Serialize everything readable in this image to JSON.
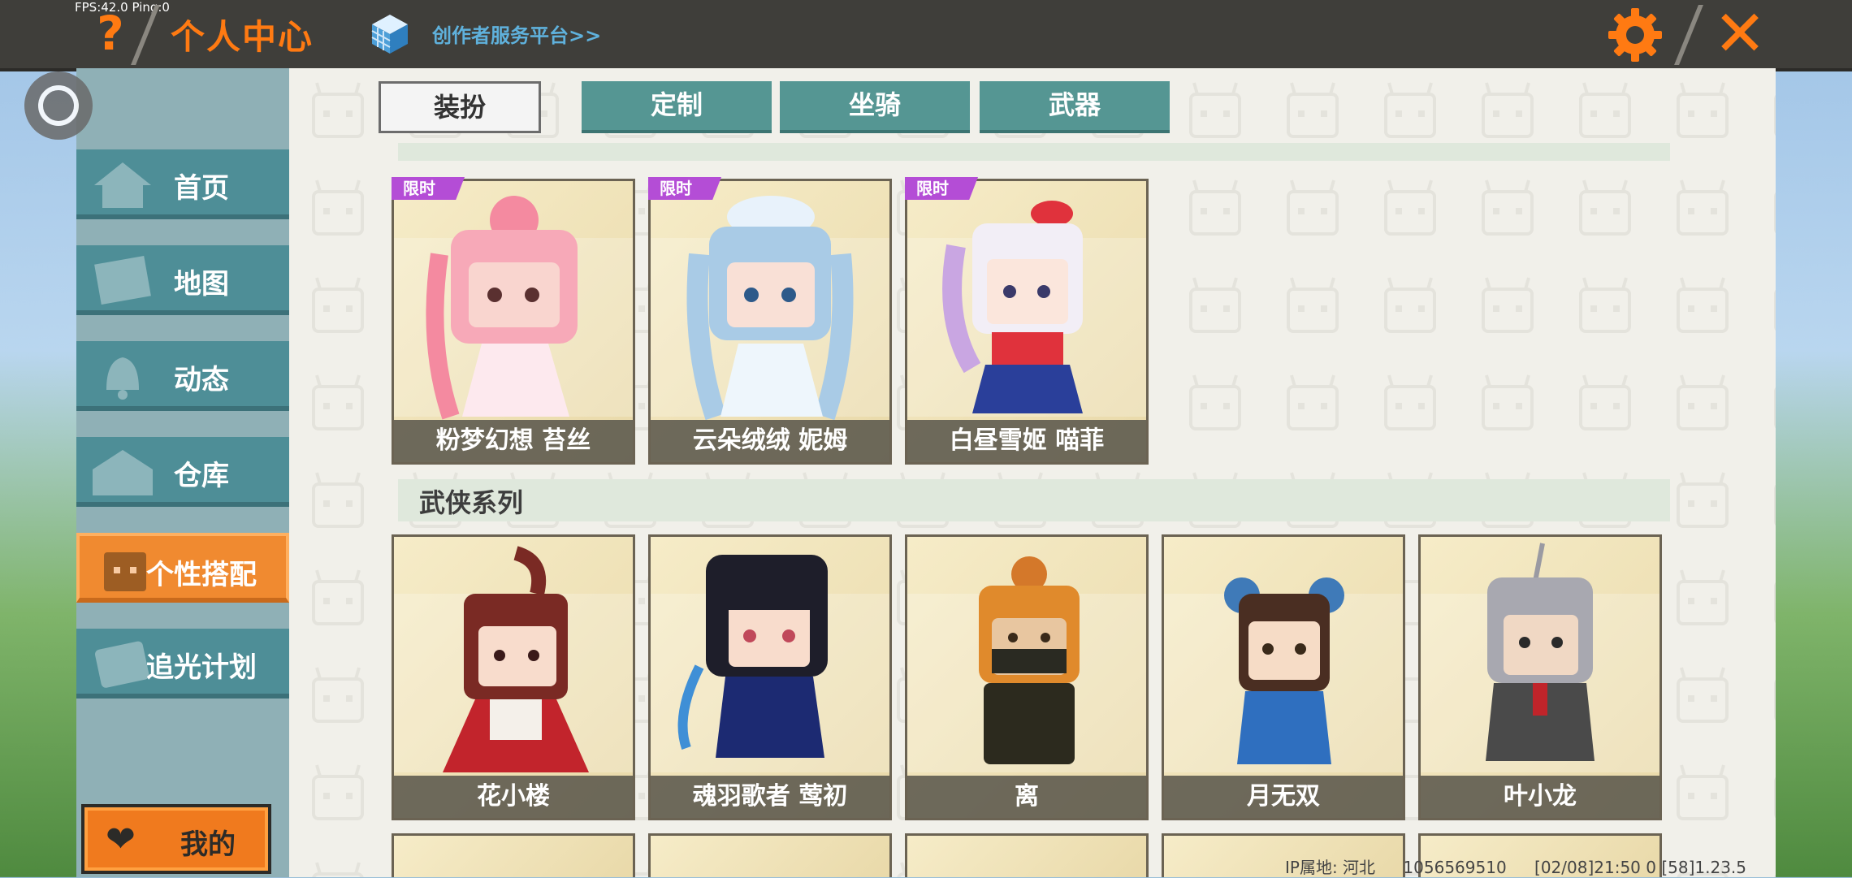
{
  "debug": {
    "fps": "FPS:42.0",
    "ping": "Ping:0"
  },
  "header": {
    "title": "个人中心",
    "creator_link": "创作者服务平台>>",
    "help_icon": "question-icon",
    "settings_icon": "gear-icon",
    "close_icon": "close-icon"
  },
  "sidebar": {
    "items": [
      {
        "label": "首页",
        "icon": "home-icon"
      },
      {
        "label": "地图",
        "icon": "map-icon"
      },
      {
        "label": "动态",
        "icon": "bell-icon"
      },
      {
        "label": "仓库",
        "icon": "warehouse-icon"
      },
      {
        "label": "个性搭配",
        "icon": "avatar-icon",
        "active": true
      },
      {
        "label": "追光计划",
        "icon": "plan-icon"
      }
    ],
    "mine_label": "我的"
  },
  "tabs": [
    {
      "label": "装扮",
      "selected": true
    },
    {
      "label": "定制"
    },
    {
      "label": "坐骑"
    },
    {
      "label": "武器"
    }
  ],
  "sections": [
    {
      "title": "",
      "cards": [
        {
          "name": "粉梦幻想 苔丝",
          "badge": "限时"
        },
        {
          "name": "云朵绒绒 妮姆",
          "badge": "限时"
        },
        {
          "name": "白昼雪姬 喵菲",
          "badge": "限时"
        }
      ]
    },
    {
      "title": "武侠系列",
      "cards": [
        {
          "name": "花小楼"
        },
        {
          "name": "魂羽歌者 莺初"
        },
        {
          "name": "离"
        },
        {
          "name": "月无双"
        },
        {
          "name": "叶小龙"
        }
      ]
    }
  ],
  "status": {
    "ip": "IP属地: 河北",
    "uid": "1056569510",
    "version": "[02/08]21:50 0  [58]1.23.5"
  },
  "colors": {
    "accent": "#ff7a12",
    "teal": "#4e8e97",
    "badge": "#b44dd6"
  }
}
